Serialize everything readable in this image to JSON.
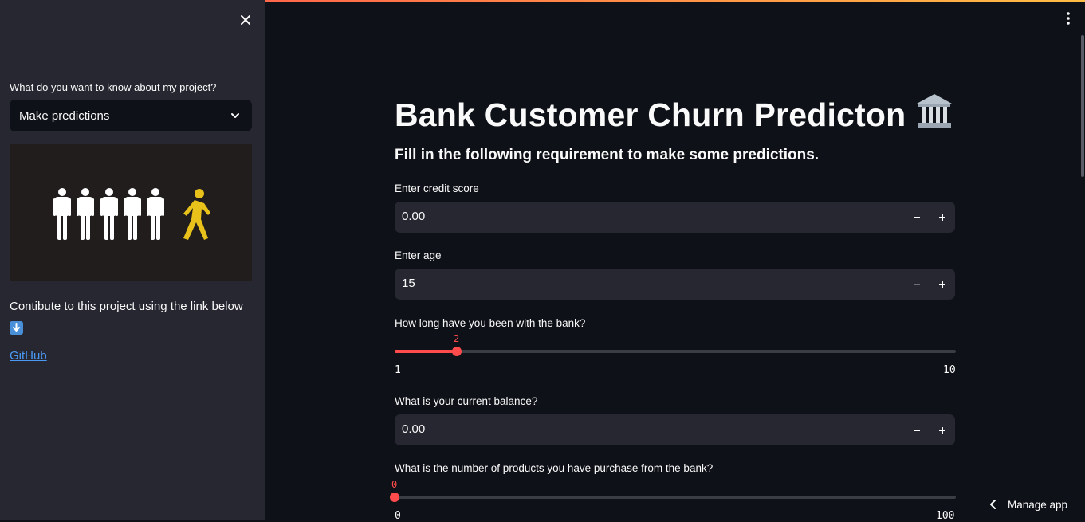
{
  "sidebar": {
    "close_icon": "close-icon",
    "question_label": "What do you want to know about my project?",
    "select_value": "Make predictions",
    "contribute_text": "Contibute to this project using the link below",
    "github_link": "GitHub"
  },
  "main": {
    "title": "Bank Customer Churn Predicton",
    "subtitle": "Fill in the following requirement to make some predictions.",
    "credit_score": {
      "label": "Enter credit score",
      "value": "0.00"
    },
    "age": {
      "label": "Enter age",
      "value": "15"
    },
    "tenure": {
      "label": "How long have you been with the bank?",
      "value": "2",
      "min": "1",
      "max": "10",
      "fraction": 0.111
    },
    "balance": {
      "label": "What is your current balance?",
      "value": "0.00"
    },
    "products": {
      "label": "What is the number of products you have purchase from the bank?",
      "value": "0",
      "min": "0",
      "max": "100",
      "fraction": 0.0
    }
  },
  "footer": {
    "manage_app": "Manage app"
  },
  "colors": {
    "accent": "#ff4b4b",
    "background": "#0e1117",
    "sidebar": "#262730",
    "link": "#4a9af5",
    "figure_highlight": "#e8c21a"
  }
}
